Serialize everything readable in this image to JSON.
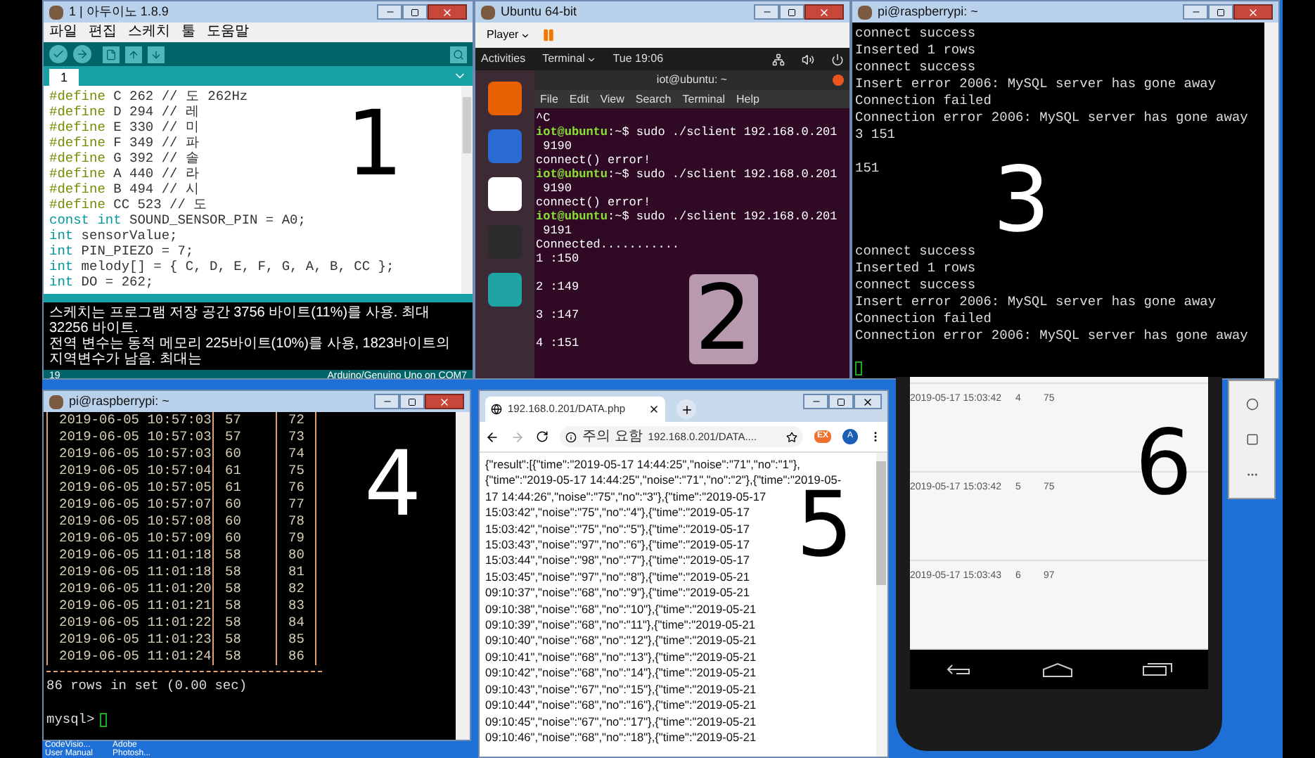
{
  "arduino": {
    "title": "1 | 아두이노 1.8.9",
    "menu": [
      "파일",
      "편집",
      "스케치",
      "툴",
      "도움말"
    ],
    "tab": "1",
    "code": [
      {
        "kind": "preprocessor",
        "keyword": "#define",
        "rest": " C 262 // 도 262Hz"
      },
      {
        "kind": "preprocessor",
        "keyword": "#define",
        "rest": " D 294 // 레"
      },
      {
        "kind": "preprocessor",
        "keyword": "#define",
        "rest": " E 330 // 미"
      },
      {
        "kind": "preprocessor",
        "keyword": "#define",
        "rest": " F 349 // 파"
      },
      {
        "kind": "preprocessor",
        "keyword": "#define",
        "rest": " G 392 // 솔"
      },
      {
        "kind": "preprocessor",
        "keyword": "#define",
        "rest": " A 440 // 라"
      },
      {
        "kind": "preprocessor",
        "keyword": "#define",
        "rest": " B 494 // 시"
      },
      {
        "kind": "preprocessor",
        "keyword": "#define",
        "rest": " CC 523 // 도"
      },
      {
        "kind": "type",
        "keyword": "const int",
        "rest": " SOUND_SENSOR_PIN = A0;"
      },
      {
        "kind": "type",
        "keyword": "int",
        "rest": " sensorValue;"
      },
      {
        "kind": "type",
        "keyword": "int",
        "rest": " PIN_PIEZO = 7;"
      },
      {
        "kind": "type",
        "keyword": "int",
        "rest": " melody[] = { C, D, E, F, G, A, B, CC };"
      },
      {
        "kind": "type",
        "keyword": "int",
        "rest": " DO = 262;"
      }
    ],
    "console": [
      "스케치는 프로그램 저장 공간 3756 바이트(11%)를 사용. 최대 32256 바이트.",
      "전역 변수는 동적 메모리 225바이트(10%)를 사용, 1823바이트의 지역변수가 남음.  최대는"
    ],
    "line_number": "19",
    "board": "Arduino/Genuino Uno on COM7",
    "annotation": "1"
  },
  "vm": {
    "title": "Ubuntu 64-bit",
    "player_menu": "Player",
    "activities": "Activities",
    "app_menu": "Terminal",
    "clock": "Tue 19:06",
    "terminal_title": "iot@ubuntu: ~",
    "menu": [
      "File",
      "Edit",
      "View",
      "Search",
      "Terminal",
      "Help"
    ],
    "lines": [
      {
        "kind": "output",
        "text": "^C"
      },
      {
        "kind": "prompt",
        "user": "iot@ubuntu",
        "text": ":~$ sudo ./sclient 192.168.0.201"
      },
      {
        "kind": "output",
        "text": " 9190"
      },
      {
        "kind": "output",
        "text": "connect() error!"
      },
      {
        "kind": "prompt",
        "user": "iot@ubuntu",
        "text": ":~$ sudo ./sclient 192.168.0.201"
      },
      {
        "kind": "output",
        "text": " 9190"
      },
      {
        "kind": "output",
        "text": "connect() error!"
      },
      {
        "kind": "prompt",
        "user": "iot@ubuntu",
        "text": ":~$ sudo ./sclient 192.168.0.201"
      },
      {
        "kind": "output",
        "text": " 9191"
      },
      {
        "kind": "output",
        "text": "Connected..........."
      }
    ],
    "readings": [
      "1 :150",
      "2 :149",
      "3 :147",
      "4 :151"
    ],
    "annotation": "2"
  },
  "log_terminal": {
    "title": "pi@raspberrypi: ~",
    "blocks": [
      [
        "connect success",
        "Inserted 1 rows",
        "connect success",
        "Insert error 2006: MySQL server has gone away",
        "Connection failed",
        "Connection error 2006: MySQL server has gone away",
        "3 151"
      ],
      [
        "151"
      ],
      [
        "connect success",
        "Inserted 1 rows",
        "connect success",
        "Insert error 2006: MySQL server has gone away",
        "Connection failed",
        "Connection error 2006: MySQL server has gone away"
      ]
    ],
    "annotation": "3"
  },
  "mysql_terminal": {
    "title": "pi@raspberrypi: ~",
    "rows": [
      [
        "2019-06-05 10:57:03",
        "57",
        "72"
      ],
      [
        "2019-06-05 10:57:03",
        "57",
        "73"
      ],
      [
        "2019-06-05 10:57:03",
        "60",
        "74"
      ],
      [
        "2019-06-05 10:57:04",
        "61",
        "75"
      ],
      [
        "2019-06-05 10:57:05",
        "61",
        "76"
      ],
      [
        "2019-06-05 10:57:07",
        "60",
        "77"
      ],
      [
        "2019-06-05 10:57:08",
        "60",
        "78"
      ],
      [
        "2019-06-05 10:57:09",
        "60",
        "79"
      ],
      [
        "2019-06-05 11:01:18",
        "58",
        "80"
      ],
      [
        "2019-06-05 11:01:18",
        "58",
        "81"
      ],
      [
        "2019-06-05 11:01:20",
        "58",
        "82"
      ],
      [
        "2019-06-05 11:01:21",
        "58",
        "83"
      ],
      [
        "2019-06-05 11:01:22",
        "58",
        "84"
      ],
      [
        "2019-06-05 11:01:23",
        "58",
        "85"
      ],
      [
        "2019-06-05 11:01:24",
        "58",
        "86"
      ]
    ],
    "summary": "86 rows in set (0.00 sec)",
    "prompt": "mysql>",
    "annotation": "4"
  },
  "browser": {
    "tab_title": "192.168.0.201/DATA.php",
    "security_label": "주의 요함",
    "url": "192.168.0.201/DATA....",
    "extension": "EX",
    "profile": "A",
    "body_lines": [
      "{\"result\":[{\"time\":\"2019-05-17 14:44:25\",\"noise\":\"71\",\"no\":\"1\"},",
      "{\"time\":\"2019-05-17 14:44:25\",\"noise\":\"71\",\"no\":\"2\"},{\"time\":\"2019-05-",
      "17 14:44:26\",\"noise\":\"75\",\"no\":\"3\"},{\"time\":\"2019-05-17",
      "15:03:42\",\"noise\":\"75\",\"no\":\"4\"},{\"time\":\"2019-05-17",
      "15:03:42\",\"noise\":\"75\",\"no\":\"5\"},{\"time\":\"2019-05-17",
      "15:03:43\",\"noise\":\"97\",\"no\":\"6\"},{\"time\":\"2019-05-17",
      "15:03:44\",\"noise\":\"98\",\"no\":\"7\"},{\"time\":\"2019-05-17",
      "15:03:45\",\"noise\":\"97\",\"no\":\"8\"},{\"time\":\"2019-05-21",
      "09:10:37\",\"noise\":\"68\",\"no\":\"9\"},{\"time\":\"2019-05-21",
      "09:10:38\",\"noise\":\"68\",\"no\":\"10\"},{\"time\":\"2019-05-21",
      "09:10:39\",\"noise\":\"68\",\"no\":\"11\"},{\"time\":\"2019-05-21",
      "09:10:40\",\"noise\":\"68\",\"no\":\"12\"},{\"time\":\"2019-05-21",
      "09:10:41\",\"noise\":\"68\",\"no\":\"13\"},{\"time\":\"2019-05-21",
      "09:10:42\",\"noise\":\"68\",\"no\":\"14\"},{\"time\":\"2019-05-21",
      "09:10:43\",\"noise\":\"67\",\"no\":\"15\"},{\"time\":\"2019-05-21",
      "09:10:44\",\"noise\":\"68\",\"no\":\"16\"},{\"time\":\"2019-05-21",
      "09:10:45\",\"noise\":\"67\",\"no\":\"17\"},{\"time\":\"2019-05-21",
      "09:10:46\",\"noise\":\"68\",\"no\":\"18\"},{\"time\":\"2019-05-21"
    ],
    "annotation": "5"
  },
  "phone": {
    "rows": [
      [
        "2019-05-17 15:03:42",
        "4",
        "75"
      ],
      [
        "2019-05-17 15:03:42",
        "5",
        "75"
      ],
      [
        "2019-05-17 15:03:43",
        "6",
        "97"
      ]
    ],
    "annotation": "6"
  },
  "desktop_icons": [
    {
      "label": "CodeVisio...",
      "sub": "User Manual"
    },
    {
      "label": "Adobe",
      "sub": "Photosh..."
    }
  ]
}
